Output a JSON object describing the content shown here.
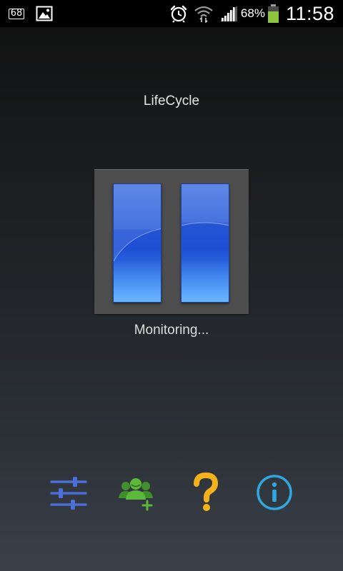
{
  "status_bar": {
    "notification_badge": "68",
    "icons": [
      "notification-count-icon",
      "image-icon",
      "alarm-icon",
      "wifi-icon",
      "signal-icon",
      "battery-icon"
    ],
    "battery_percent": "68%",
    "battery_level": 0.68,
    "battery_color": "#8cc63e",
    "time": "11:58"
  },
  "app": {
    "title": "LifeCycle",
    "status": "Monitoring...",
    "monitor_button": {
      "icon": "pause-icon",
      "accent_color": "#2a5fe0"
    }
  },
  "toolbar": {
    "items": [
      {
        "icon": "sliders-icon",
        "color": "#4a6fd8"
      },
      {
        "icon": "add-contacts-icon",
        "color": "#5cb83a"
      },
      {
        "icon": "help-question-icon",
        "color": "#f5b21a"
      },
      {
        "icon": "info-icon",
        "color": "#2fa7e0"
      }
    ]
  }
}
